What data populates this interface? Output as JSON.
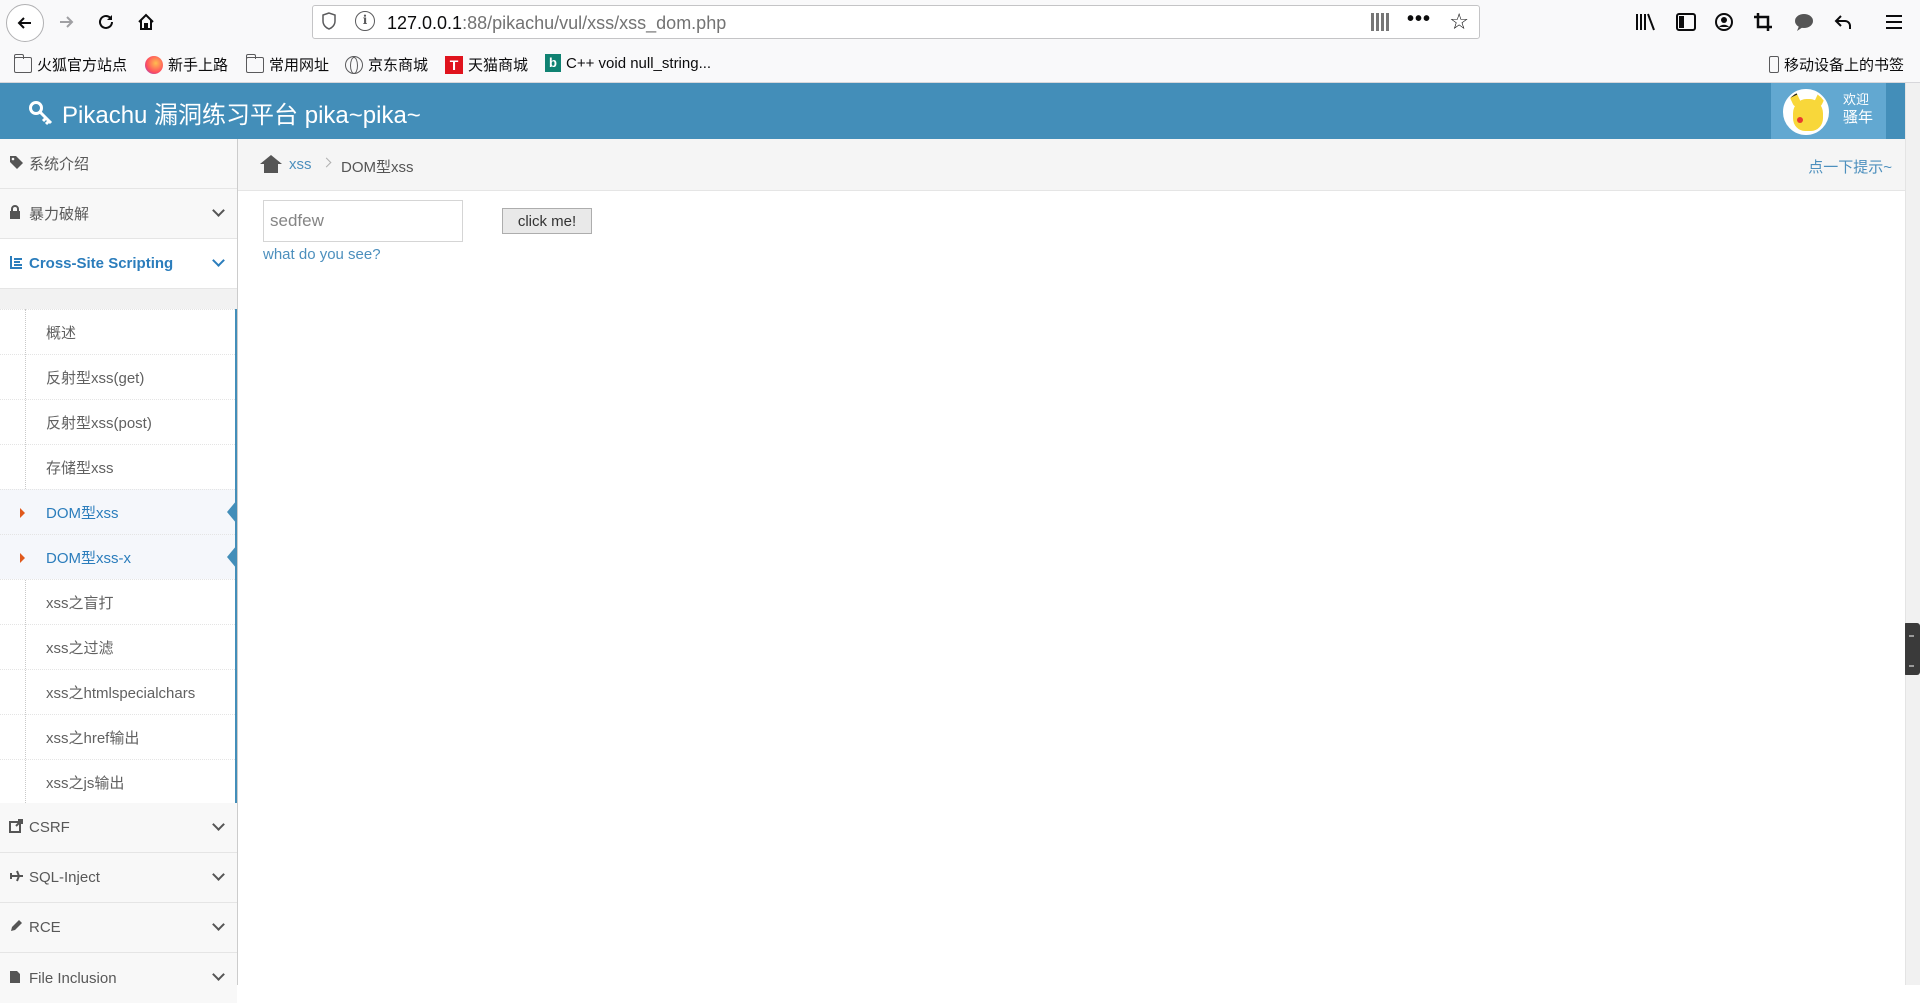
{
  "browser": {
    "url_host": "127.0.0.1",
    "url_rest": ":88/pikachu/vul/xss/xss_dom.php",
    "bookmarks": [
      "火狐官方站点",
      "新手上路",
      "常用网址",
      "京东商城",
      "天猫商城",
      "C++ void null_string..."
    ],
    "mobile_bookmarks": "移动设备上的书签",
    "tmall_glyph": "T",
    "bing_glyph": "b"
  },
  "header": {
    "brand": "Pikachu 漏洞练习平台 pika~pika~",
    "welcome": "欢迎",
    "user": "骚年"
  },
  "sidebar": {
    "items": [
      {
        "label": "系统介绍",
        "icon": "tags-icon"
      },
      {
        "label": "暴力破解",
        "icon": "lock-icon"
      },
      {
        "label": "Cross-Site Scripting",
        "icon": "list-icon"
      },
      {
        "label": "CSRF",
        "icon": "share-icon"
      },
      {
        "label": "SQL-Inject",
        "icon": "plane-icon"
      },
      {
        "label": "RCE",
        "icon": "pencil-icon"
      },
      {
        "label": "File Inclusion",
        "icon": "file-icon"
      }
    ],
    "xss_sub": [
      "概述",
      "反射型xss(get)",
      "反射型xss(post)",
      "存储型xss",
      "DOM型xss",
      "DOM型xss-x",
      "xss之盲打",
      "xss之过滤",
      "xss之htmlspecialchars",
      "xss之href输出",
      "xss之js输出"
    ]
  },
  "breadcrumb": {
    "parent": "xss",
    "current": "DOM型xss",
    "hint": "点一下提示~"
  },
  "main": {
    "input_value": "sedfew",
    "button_label": "click me!",
    "link_text": "what do you see?"
  },
  "colors": {
    "navbar": "#438eb9",
    "link": "#4c8fbd",
    "active_marker": "#e0591c"
  }
}
